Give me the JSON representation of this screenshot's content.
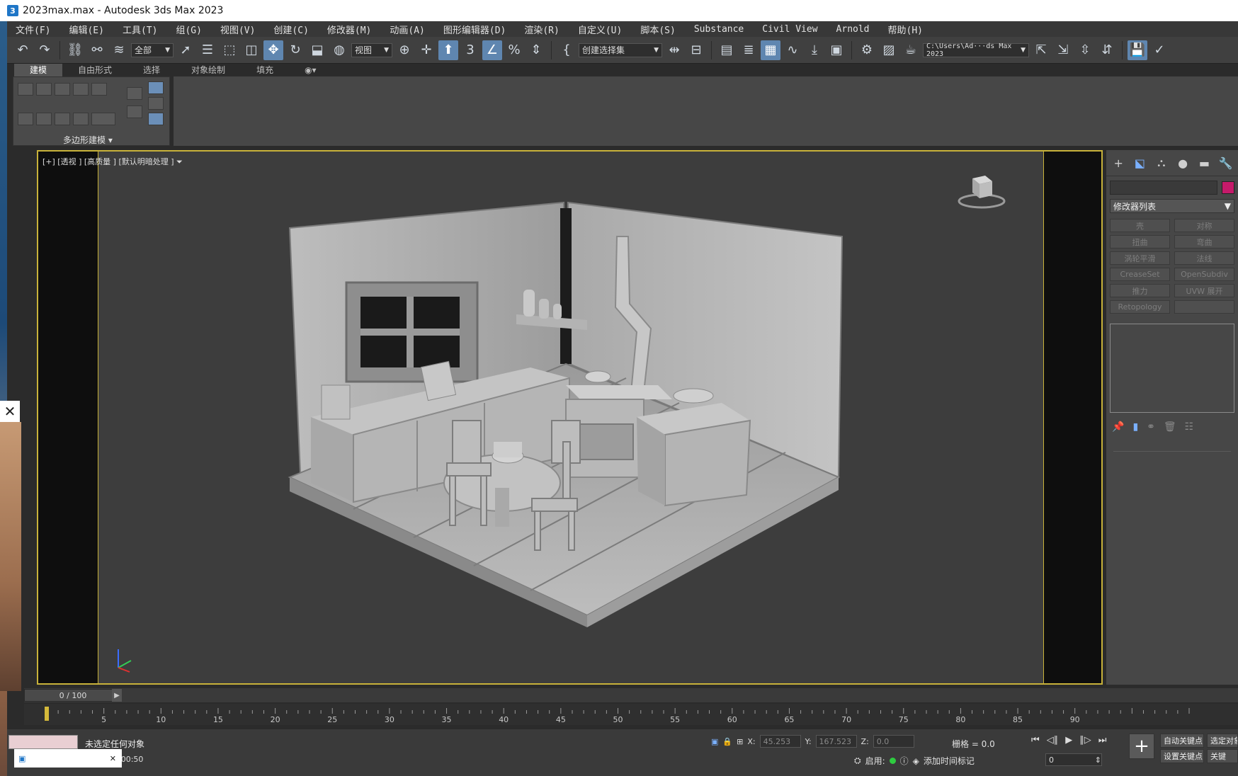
{
  "window": {
    "title": "2023max.max - Autodesk 3ds Max 2023",
    "icon": "3"
  },
  "menu": [
    "文件(F)",
    "编辑(E)",
    "工具(T)",
    "组(G)",
    "视图(V)",
    "创建(C)",
    "修改器(M)",
    "动画(A)",
    "图形编辑器(D)",
    "渲染(R)",
    "自定义(U)",
    "脚本(S)",
    "Substance",
    "Civil View",
    "Arnold",
    "帮助(H)"
  ],
  "toolbar": {
    "selection_filter": "全部",
    "ref_coord": "视图",
    "named_selection": "创建选择集",
    "project_path": "C:\\Users\\Ad···ds Max 2023"
  },
  "ribbon": {
    "tabs": [
      "建模",
      "自由形式",
      "选择",
      "对象绘制",
      "填充"
    ],
    "active_tab": 0,
    "panel_label": "多边形建模"
  },
  "viewport": {
    "label": "[+] [透视 ] [高质量 ] [默认明暗处理 ]"
  },
  "command_panel": {
    "modifier_list": "修改器列表",
    "modifier_buttons": [
      "壳",
      "对称",
      "扭曲",
      "弯曲",
      "涡轮平滑",
      "法线",
      "CreaseSet",
      "OpenSubdiv",
      "推力",
      "UVW 展开",
      "Retopology",
      ""
    ],
    "accent_color": "#c51a6a"
  },
  "timeline": {
    "slider_label": "0 / 100",
    "ticks": [
      5,
      10,
      15,
      20,
      25,
      30,
      35,
      40,
      45,
      50,
      55,
      60,
      65,
      70,
      75,
      80,
      85,
      90
    ]
  },
  "status": {
    "message": "未选定任何对象",
    "time_label": "0:00:50",
    "x_label": "X:",
    "x_value": "45.253",
    "y_label": "Y:",
    "y_value": "167.523",
    "z_label": "Z:",
    "z_value": "0.0",
    "grid": "栅格 = 0.0",
    "enable_label": "启用:",
    "add_time_tag": "添加时间标记",
    "frame_value": "0",
    "auto_key": "自动关键点",
    "selected_objects": "选定对象",
    "set_key": "设置关键点",
    "key_filters": "关键"
  },
  "colors": {
    "viewport_border": "#c8b23a",
    "active_tool": "#5f86b0",
    "ui_dark": "#383838"
  }
}
